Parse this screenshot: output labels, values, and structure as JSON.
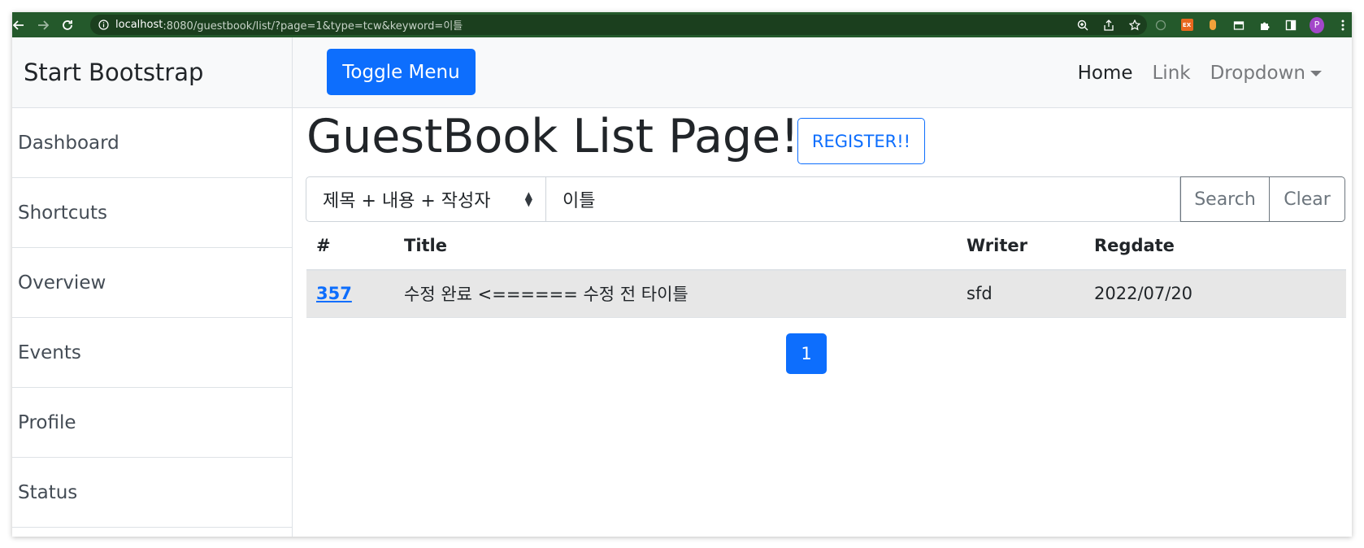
{
  "browser": {
    "url_host": "localhost",
    "url_rest": ":8080/guestbook/list/?page=1&type=tcw&keyword=이틀",
    "profile_initial": "P",
    "ext_badge": "EX"
  },
  "sidebar": {
    "heading": "Start Bootstrap",
    "items": [
      {
        "label": "Dashboard"
      },
      {
        "label": "Shortcuts"
      },
      {
        "label": "Overview"
      },
      {
        "label": "Events"
      },
      {
        "label": "Profile"
      },
      {
        "label": "Status"
      }
    ]
  },
  "topnav": {
    "toggle_label": "Toggle Menu",
    "links": [
      {
        "label": "Home"
      },
      {
        "label": "Link"
      },
      {
        "label": "Dropdown"
      }
    ]
  },
  "main": {
    "title": "GuestBook List Page!!!!",
    "register_label": "REGISTER!!",
    "search": {
      "type_selected": "제목 + 내용 + 작성자",
      "keyword": "이틀",
      "search_label": "Search",
      "clear_label": "Clear"
    },
    "table": {
      "headers": [
        "#",
        "Title",
        "Writer",
        "Regdate"
      ],
      "rows": [
        {
          "id": "357",
          "title": "수정 완료 <====== 수정 전 타이틀",
          "writer": "sfd",
          "regdate": "2022/07/20"
        }
      ]
    },
    "pagination": {
      "current": "1"
    }
  },
  "colors": {
    "browser_bar": "#24592b",
    "primary": "#0d6efd",
    "sidebar_bg": "#f8f9fa",
    "row_highlight": "#e7e7e7"
  }
}
